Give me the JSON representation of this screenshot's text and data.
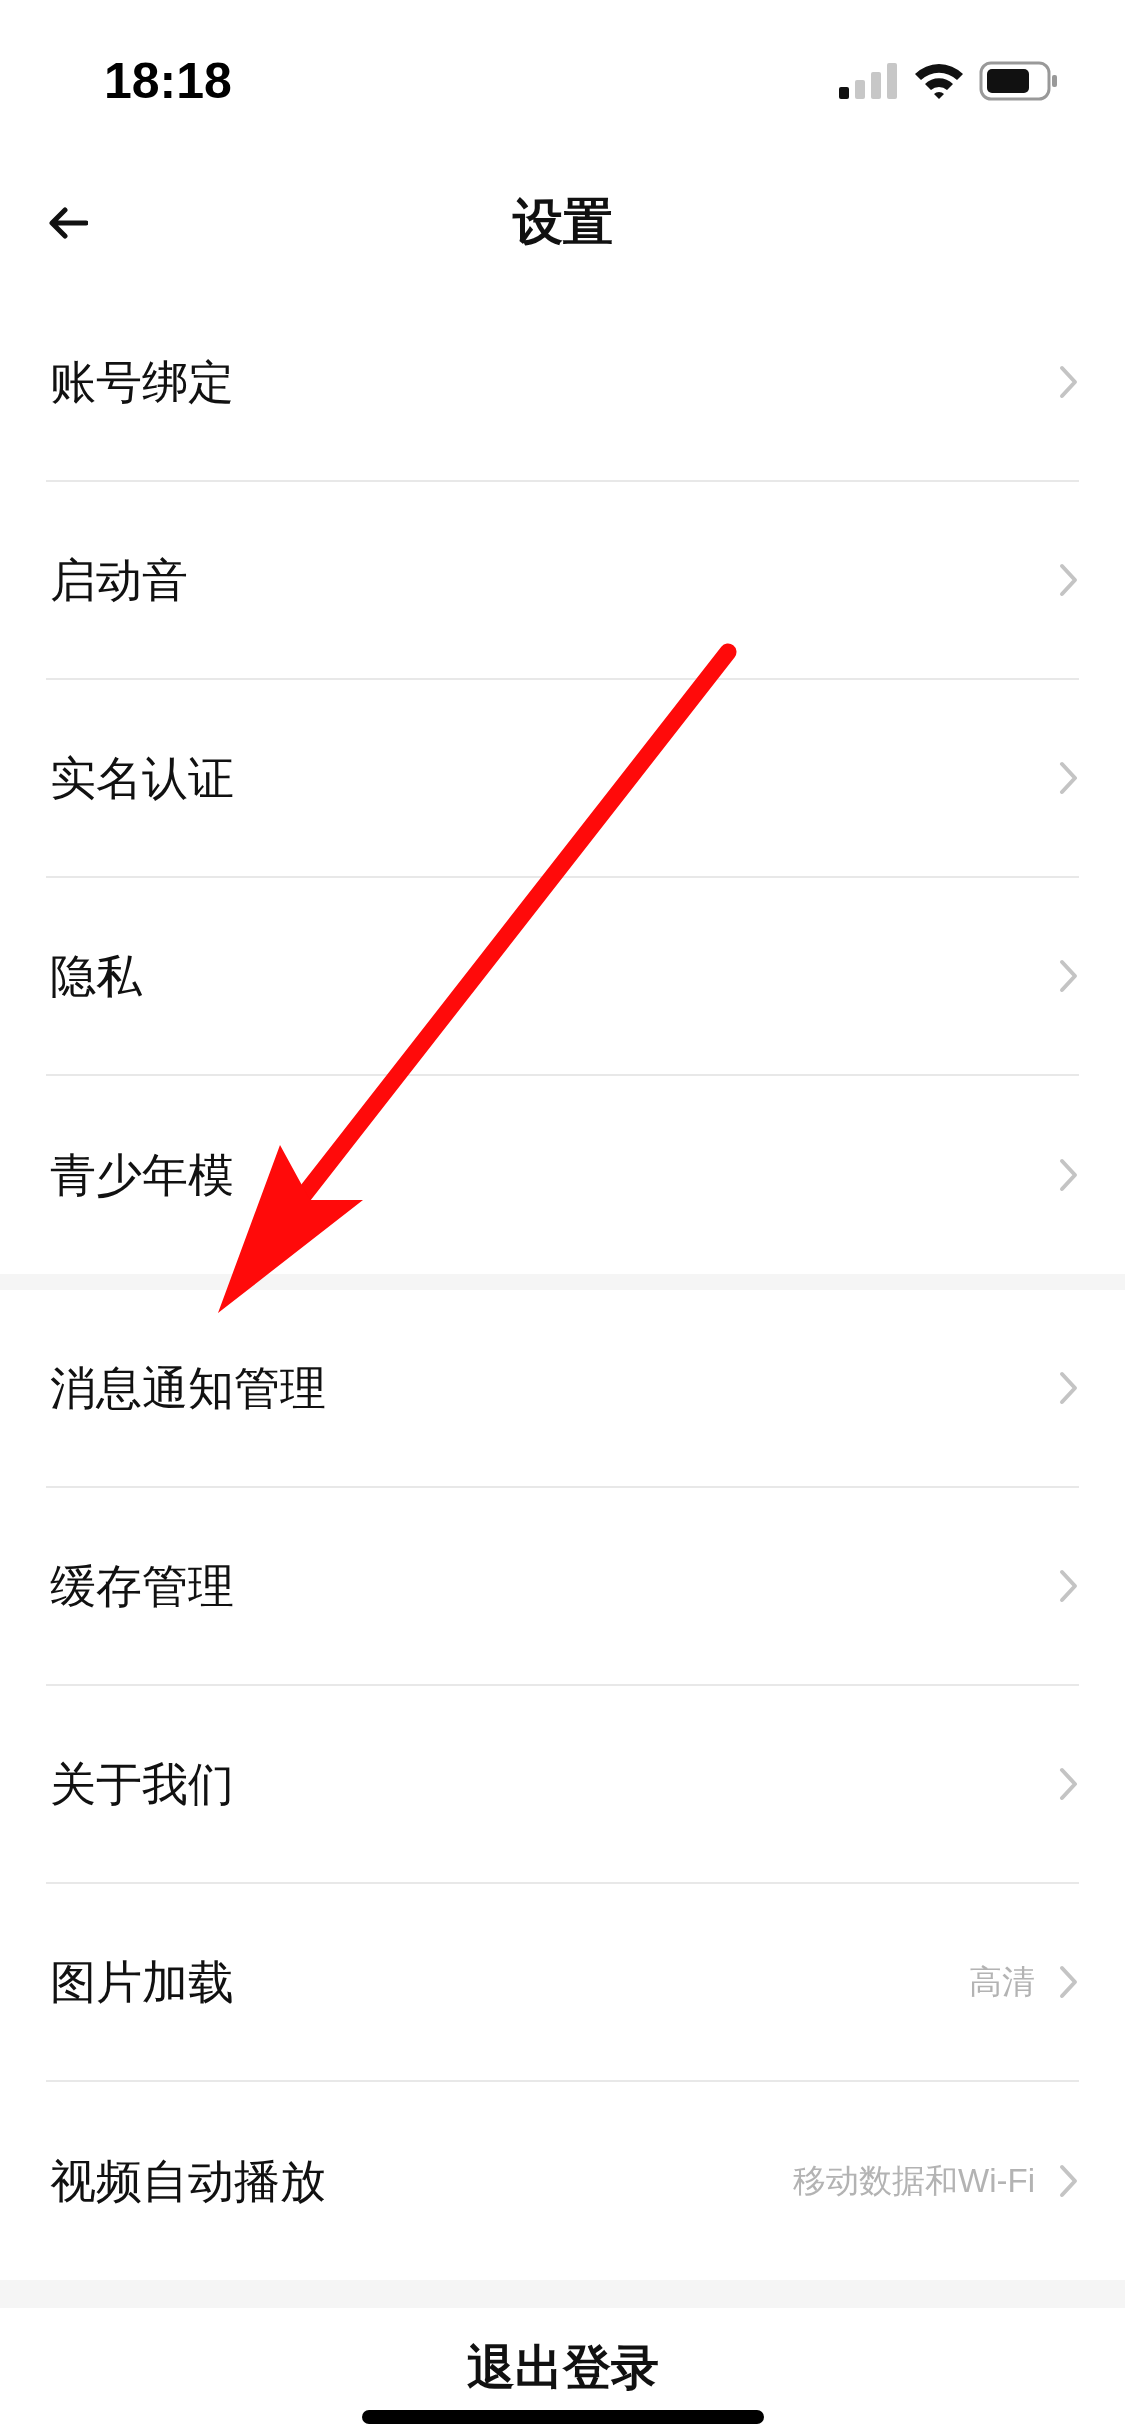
{
  "status_bar": {
    "time": "18:18"
  },
  "header": {
    "title": "设置"
  },
  "groups": [
    {
      "items": [
        {
          "label": "账号绑定"
        },
        {
          "label": "启动音"
        },
        {
          "label": "实名认证"
        },
        {
          "label": "隐私"
        },
        {
          "label": "青少年模"
        }
      ]
    },
    {
      "items": [
        {
          "label": "消息通知管理"
        },
        {
          "label": "缓存管理"
        },
        {
          "label": "关于我们"
        },
        {
          "label": "图片加载",
          "value": "高清"
        },
        {
          "label": "视频自动播放",
          "value": "移动数据和Wi-Fi"
        }
      ]
    }
  ],
  "logout": {
    "label": "退出登录"
  }
}
